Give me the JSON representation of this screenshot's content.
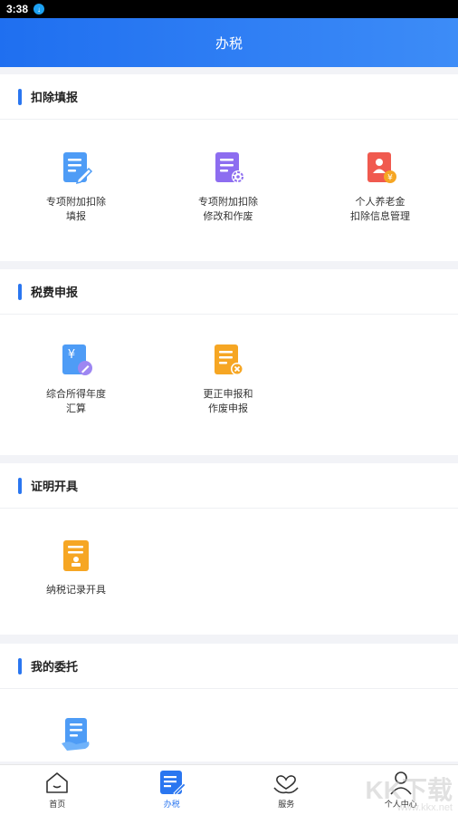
{
  "status": {
    "time": "3:38"
  },
  "header": {
    "title": "办税"
  },
  "sections": [
    {
      "title": "扣除填报",
      "items": [
        {
          "label": "专项附加扣除\n填报",
          "icon": "document-edit-icon"
        },
        {
          "label": "专项附加扣除\n修改和作废",
          "icon": "document-settings-icon"
        },
        {
          "label": "个人养老金\n扣除信息管理",
          "icon": "pension-icon"
        }
      ]
    },
    {
      "title": "税费申报",
      "items": [
        {
          "label": "综合所得年度\n汇算",
          "icon": "yuan-document-icon"
        },
        {
          "label": "更正申报和\n作废申报",
          "icon": "document-cancel-icon"
        }
      ]
    },
    {
      "title": "证明开具",
      "items": [
        {
          "label": "纳税记录开具",
          "icon": "tax-record-icon"
        }
      ]
    },
    {
      "title": "我的委托",
      "items": [
        {
          "label": "",
          "icon": "delegation-icon"
        }
      ]
    }
  ],
  "tabs": [
    {
      "label": "首页",
      "icon": "home-icon",
      "active": false
    },
    {
      "label": "办税",
      "icon": "tax-icon",
      "active": true
    },
    {
      "label": "服务",
      "icon": "service-icon",
      "active": false
    },
    {
      "label": "个人中心",
      "icon": "user-icon",
      "active": false
    }
  ],
  "watermark": {
    "brand": "KK下载",
    "site": "www.kkx.net"
  },
  "colors": {
    "primary": "#2a76f0",
    "header_start": "#1f6ff0",
    "header_end": "#3d8cf7"
  }
}
